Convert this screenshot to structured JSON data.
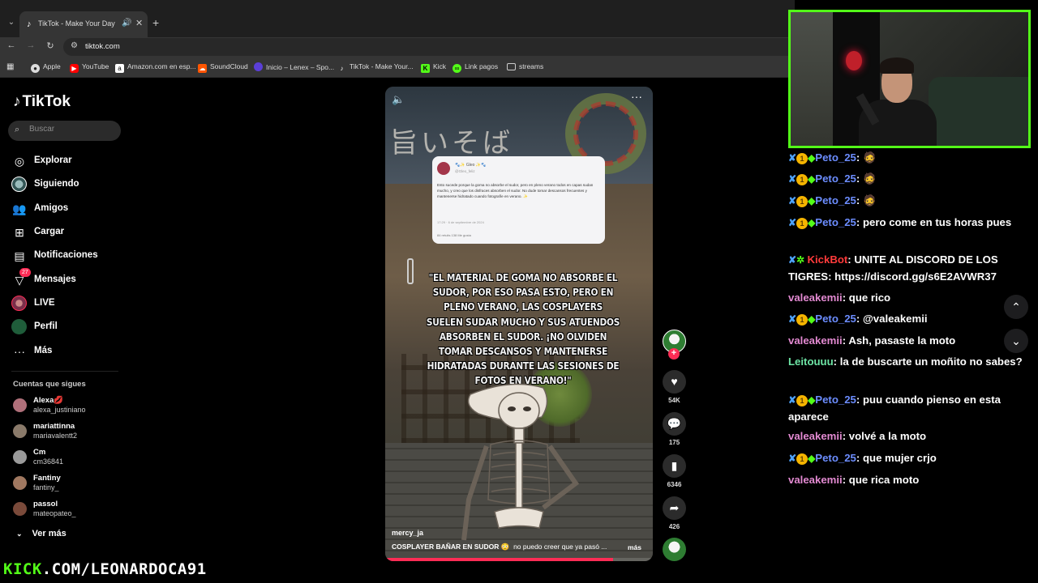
{
  "browser": {
    "tab_title": "TikTok - Make Your Day",
    "url": "tiktok.com",
    "bookmarks": [
      {
        "label": "Apple",
        "icon": "apple-icon",
        "color": "#dddddd"
      },
      {
        "label": "YouTube",
        "icon": "youtube-icon",
        "color": "#ff0000"
      },
      {
        "label": "Amazon.com en esp...",
        "icon": "amazon-icon",
        "color": "#ffffff"
      },
      {
        "label": "SoundCloud",
        "icon": "soundcloud-icon",
        "color": "#ff5500"
      },
      {
        "label": "Inicio – Lenex – Spo...",
        "icon": "spotify-icon",
        "color": "#5b3fd8"
      },
      {
        "label": "TikTok - Make Your...",
        "icon": "tiktok-icon",
        "color": "#ffffff"
      },
      {
        "label": "Kick",
        "icon": "kick-icon",
        "color": "#53fc18"
      },
      {
        "label": "Link pagos",
        "icon": "link-icon",
        "color": "#53fc18"
      },
      {
        "label": "streams",
        "icon": "folder-icon",
        "color": "#cccccc"
      }
    ]
  },
  "tiktok": {
    "logo": "TikTok",
    "search_placeholder": "Buscar",
    "nav": [
      {
        "label": "Explorar",
        "icon": "compass-icon"
      },
      {
        "label": "Siguiendo",
        "icon": "following-avatar-icon"
      },
      {
        "label": "Amigos",
        "icon": "friends-icon"
      },
      {
        "label": "Cargar",
        "icon": "upload-icon"
      },
      {
        "label": "Notificaciones",
        "icon": "notification-icon"
      },
      {
        "label": "Mensajes",
        "icon": "messages-icon",
        "badge": "27"
      },
      {
        "label": "LIVE",
        "icon": "live-icon"
      },
      {
        "label": "Perfil",
        "icon": "profile-icon"
      },
      {
        "label": "Más",
        "icon": "more-icon"
      }
    ],
    "following_title": "Cuentas que sigues",
    "following": [
      {
        "name": "Alexa💋",
        "handle": "alexa_justiniano",
        "color": "#b0707a"
      },
      {
        "name": "mariattinna",
        "handle": "mariavalentt2",
        "color": "#8a7a6a"
      },
      {
        "name": "Cm",
        "handle": "cm36841",
        "color": "#9a9a9a"
      },
      {
        "name": "Fantiny",
        "handle": "fantiny_",
        "color": "#a07860"
      },
      {
        "name": "passol",
        "handle": "mateopateo_",
        "color": "#7a4a3a"
      }
    ],
    "ver_mas": "Ver más"
  },
  "video": {
    "kanji": "旨いそば",
    "tweet": {
      "name": "🐾✨ Gleo ✨🐾",
      "handle": "@Gleo_feliz",
      "body": "Esto sucede porque la goma no absorbe el sudor, pero en pleno verano todos en capas sudan mucho, y creo que los disfraces absorben el sudor. No dude tomar descansos frecuentes y mantenerse hidratado cuando fotografíe en verano. ✨",
      "meta": "17:29 · 6 de septiembre de 2024",
      "stats": "84 retuits      138 Me gusta"
    },
    "quote": "\"EL MATERIAL DE GOMA NO ABSORBE EL SUDOR, POR ESO PASA ESTO, PERO EN PLENO VERANO, LAS COSPLAYERS SUELEN SUDAR MUCHO Y SUS ATUENDOS ABSORBEN EL SUDOR. ¡NO OLVIDEN TOMAR DESCANSOS Y MANTENERSE HIDRATADAS DURANTE LAS SESIONES DE FOTOS EN VERANO!\"",
    "author": "mercy_ja",
    "caption": "COSPLAYER BAÑAR EN SUDOR 😳",
    "caption_rest": "no puedo creer que ya pasó ...",
    "more": "más",
    "progress": 0.85,
    "actions": {
      "likes": "54K",
      "comments": "175",
      "saves": "6346",
      "shares": "426"
    }
  },
  "chat": [
    {
      "badges": true,
      "user": "Peto_25",
      "color": "#6c8dff",
      "text": "🧔"
    },
    {
      "badges": true,
      "user": "Peto_25",
      "color": "#6c8dff",
      "text": "🧔"
    },
    {
      "badges": true,
      "user": "Peto_25",
      "color": "#6c8dff",
      "text": "🧔"
    },
    {
      "badges": true,
      "user": "Peto_25",
      "color": "#6c8dff",
      "text": "pero come en tus horas pues"
    },
    {
      "badges": true,
      "bot": true,
      "user": "KickBot",
      "color": "#ff3b3b",
      "text": "UNITE AL DISCORD DE LOS TIGRES: https://discord.gg/s6E2AVWR37"
    },
    {
      "badges": false,
      "user": "valeakemii",
      "color": "#e38ad2",
      "text": "que rico"
    },
    {
      "badges": true,
      "user": "Peto_25",
      "color": "#6c8dff",
      "text": "@valeakemii"
    },
    {
      "badges": false,
      "user": "valeakemii",
      "color": "#e38ad2",
      "text": "Ash, pasaste la moto"
    },
    {
      "badges": false,
      "user": "Leitouuu",
      "color": "#6ee6a6",
      "text": "la de buscarte un moñito no sabes?"
    },
    {
      "badges": true,
      "user": "Peto_25",
      "color": "#6c8dff",
      "text": "puu cuando pienso en esta aparece"
    },
    {
      "badges": false,
      "user": "valeakemii",
      "color": "#e38ad2",
      "text": "volvé a la moto"
    },
    {
      "badges": true,
      "user": "Peto_25",
      "color": "#6c8dff",
      "text": "que mujer crjo"
    },
    {
      "badges": false,
      "user": "valeakemii",
      "color": "#e38ad2",
      "text": "que rica moto"
    }
  ],
  "overlay": {
    "kick": "KICK",
    "rest": ".COM/LEONARDOCA91"
  },
  "colors": {
    "kick_green": "#53fc18",
    "tiktok_red": "#fe2c55"
  }
}
